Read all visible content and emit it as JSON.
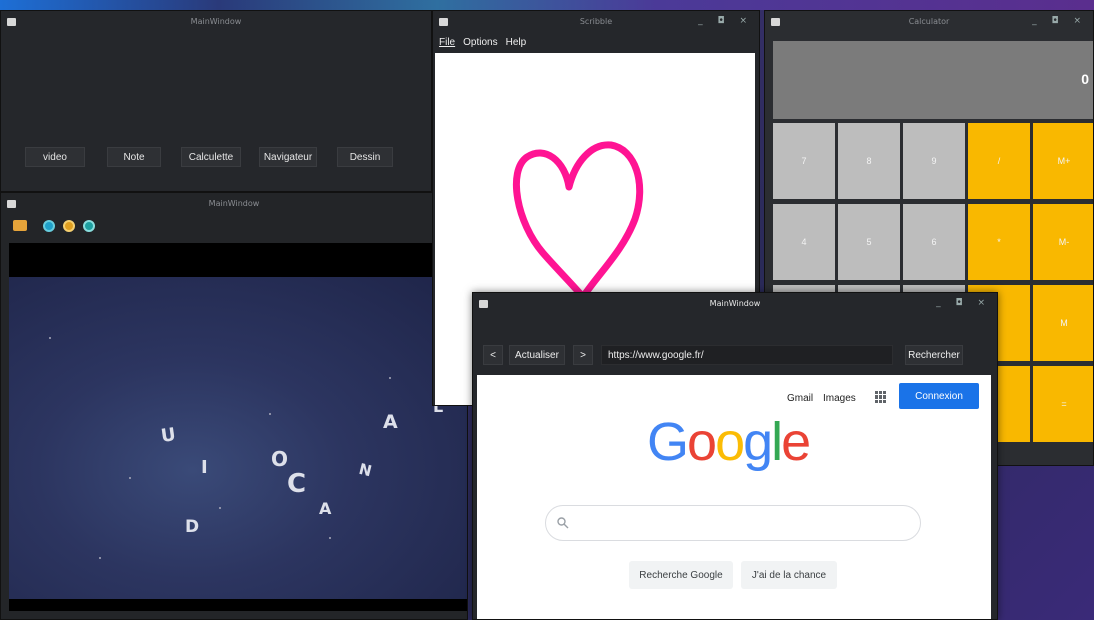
{
  "launcher": {
    "title": "MainWindow",
    "buttons": [
      "video",
      "Note",
      "Calculette",
      "Navigateur",
      "Dessin"
    ]
  },
  "video_player": {
    "title": "MainWindow",
    "toolbar_icons": [
      "folder-icon",
      "play-icon",
      "pause-icon",
      "stop-icon"
    ],
    "letters": [
      "U",
      "I",
      "D",
      "O",
      "C",
      "A",
      "N",
      "A",
      "L"
    ]
  },
  "scribble": {
    "title": "Scribble",
    "menu": [
      "File",
      "Options",
      "Help"
    ],
    "window_controls": "_ ◘ ×",
    "stroke_color": "#ff1493"
  },
  "calculator": {
    "title": "Calculator",
    "display": "0",
    "window_controls": "_ ◘ ×",
    "keys": [
      "7",
      "8",
      "9",
      "/",
      "M+",
      "4",
      "5",
      "6",
      "*",
      "M-",
      "M",
      "="
    ],
    "number_color": "#bdbdbd",
    "operator_color": "#f9b800"
  },
  "browser": {
    "title": "MainWindow",
    "window_controls": "_ ◘ ×",
    "back_label": "<",
    "reload_label": "Actualiser",
    "forward_label": ">",
    "url": "https://www.google.fr/",
    "search_label": "Rechercher",
    "page": {
      "gmail": "Gmail",
      "images": "Images",
      "signin": "Connexion",
      "logo": [
        "G",
        "o",
        "o",
        "g",
        "l",
        "e"
      ],
      "logo_colors": [
        "#4285f4",
        "#ea4335",
        "#fbbc05",
        "#4285f4",
        "#34a853",
        "#ea4335"
      ],
      "search_button": "Recherche Google",
      "lucky_button": "J'ai de la chance"
    }
  }
}
